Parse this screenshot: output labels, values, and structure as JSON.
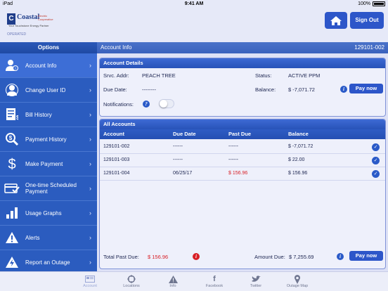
{
  "status_bar": {
    "device": "iPad",
    "time": "9:41 AM",
    "battery": "100%"
  },
  "header": {
    "logo_name": "Coastal",
    "logo_sub": "Electric Cooperative",
    "logo_tagline": "Your Touchstone Energy Partner",
    "logo_small": "OPERATED"
  },
  "sign_out_label": "Sign Out",
  "sidebar": {
    "title": "Options",
    "items": [
      {
        "label": "Account Info",
        "icon": "user-info-icon"
      },
      {
        "label": "Change User ID",
        "icon": "user-switch-icon"
      },
      {
        "label": "Bill History",
        "icon": "bill-icon"
      },
      {
        "label": "Payment History",
        "icon": "magnifier-dollar-icon"
      },
      {
        "label": "Make Payment",
        "icon": "dollar-icon"
      },
      {
        "label": "One-time Scheduled Payment",
        "icon": "card-check-icon"
      },
      {
        "label": "Usage Graphs",
        "icon": "bar-chart-icon"
      },
      {
        "label": "Alerts",
        "icon": "warning-icon"
      },
      {
        "label": "Report an Outage",
        "icon": "lightning-icon"
      }
    ]
  },
  "main": {
    "title": "Account Info",
    "account_number": "129101-002",
    "details": {
      "title": "Account Details",
      "srvc_label": "Srvc. Addr:",
      "srvc_value": "PEACH TREE",
      "status_label": "Status:",
      "status_value": "ACTIVE PPM",
      "due_label": "Due Date:",
      "due_value": "--------",
      "balance_label": "Balance:",
      "balance_value": "$ -7,071.72",
      "notifications_label": "Notifications:",
      "pay_now": "Pay now"
    },
    "all_accounts": {
      "title": "All Accounts",
      "columns": [
        "Account",
        "Due Date",
        "Past Due",
        "Balance"
      ],
      "rows": [
        {
          "account": "129101-002",
          "due": "------",
          "past_due": "------",
          "balance": "$ -7,071.72"
        },
        {
          "account": "129101-003",
          "due": "------",
          "past_due": "------",
          "balance": "$ 22.00"
        },
        {
          "account": "129101-004",
          "due": "06/25/17",
          "past_due": "$ 156.96",
          "balance": "$ 156.96"
        }
      ],
      "total_past_due_label": "Total Past Due:",
      "total_past_due_value": "$ 156.96",
      "amount_due_label": "Amount Due:",
      "amount_due_value": "$ 7,255.69",
      "pay_now": "Pay now"
    }
  },
  "tabbar": [
    {
      "label": "Account",
      "icon": "account-icon"
    },
    {
      "label": "Locations",
      "icon": "locations-icon"
    },
    {
      "label": "Info",
      "icon": "info-triangle-icon"
    },
    {
      "label": "Facebook",
      "icon": "facebook-icon"
    },
    {
      "label": "Twitter",
      "icon": "twitter-icon"
    },
    {
      "label": "Outage Map",
      "icon": "map-pin-icon"
    }
  ],
  "colors": {
    "primary": "#2d56c9",
    "sidebar": "#2b5cbf",
    "past_due_red": "#d81f26",
    "background": "#dde1f6"
  }
}
